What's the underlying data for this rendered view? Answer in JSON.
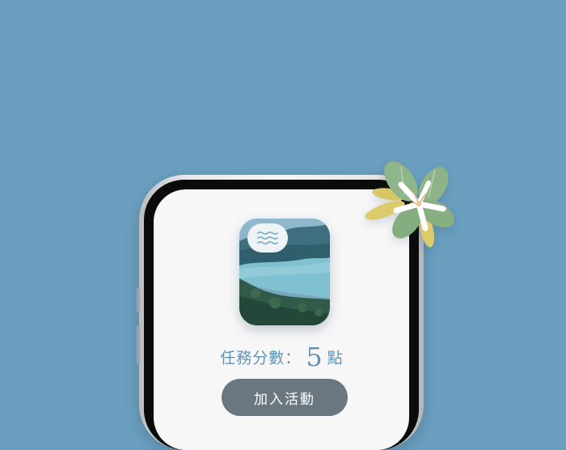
{
  "activity": {
    "icon": "waves-icon",
    "score_label": "任務分數：",
    "score_value": "5",
    "score_unit": "點",
    "join_button_label": "加入活動"
  },
  "colors": {
    "background": "#6a9fbf",
    "accent": "#5e94b8",
    "button": "#6a7780",
    "screen": "#f7f7f8"
  }
}
